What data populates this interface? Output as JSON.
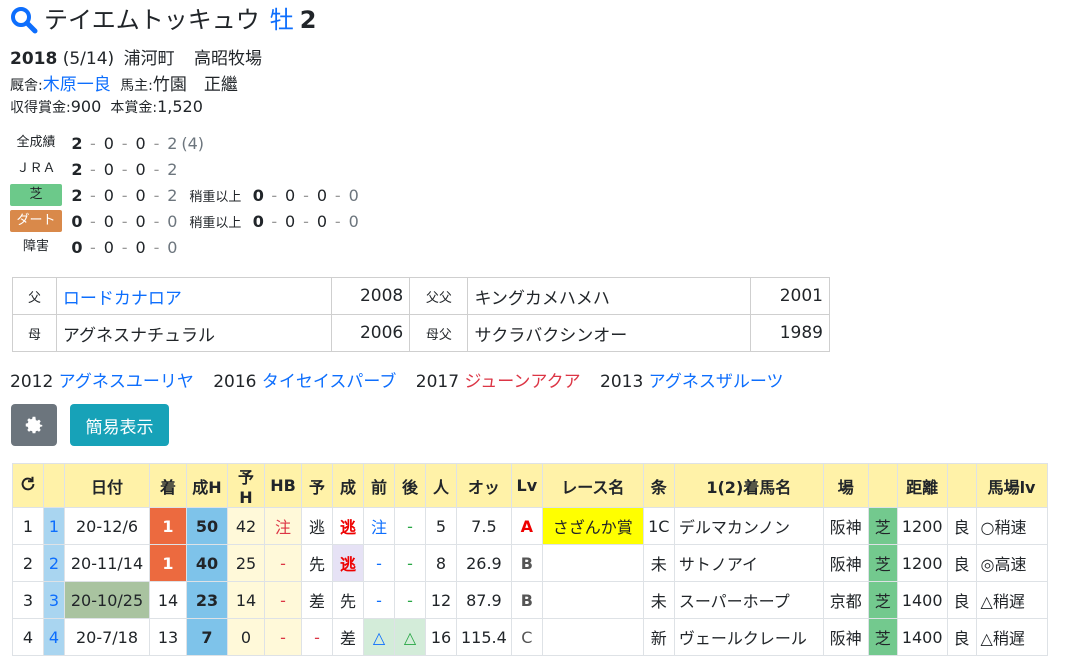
{
  "horse": {
    "name": "テイエムトッキュウ",
    "sex": "牡",
    "age": "2",
    "birth_year": "2018",
    "birth_date": "(5/14)",
    "place": "浦河町",
    "farm": "高昭牧場",
    "trainer_label": "厩舎:",
    "trainer": "木原一良",
    "owner_label": "馬主:",
    "owner": "竹園　正繼",
    "prize_label": "収得賞金:",
    "prize": "900",
    "total_prize_label": "本賞金:",
    "total_prize": "1,520"
  },
  "records": [
    {
      "label": "全成績",
      "vals": [
        "2",
        "0",
        "0",
        "2"
      ],
      "extra": "(4)"
    },
    {
      "label": "ＪＲＡ",
      "vals": [
        "2",
        "0",
        "0",
        "2"
      ]
    },
    {
      "label": "芝",
      "vals": [
        "2",
        "0",
        "0",
        "2"
      ],
      "sub_label": "稍重以上",
      "sub_vals": [
        "0",
        "0",
        "0",
        "0"
      ]
    },
    {
      "label": "ダート",
      "vals": [
        "0",
        "0",
        "0",
        "0"
      ],
      "sub_label": "稍重以上",
      "sub_vals": [
        "0",
        "0",
        "0",
        "0"
      ]
    },
    {
      "label": "障害",
      "vals": [
        "0",
        "0",
        "0",
        "0"
      ]
    }
  ],
  "pedigree": {
    "sire_label": "父",
    "sire": "ロードカナロア",
    "sire_year": "2008",
    "sire_sire_label": "父父",
    "sire_sire": "キングカメハメハ",
    "sire_sire_year": "2001",
    "dam_label": "母",
    "dam": "アグネスナチュラル",
    "dam_year": "2006",
    "dam_sire_label": "母父",
    "dam_sire": "サクラバクシンオー",
    "dam_sire_year": "1989"
  },
  "siblings": [
    {
      "year": "2012",
      "name": "アグネスユーリヤ",
      "color": "#0d6efd"
    },
    {
      "year": "2016",
      "name": "タイセイスパーブ",
      "color": "#0d6efd"
    },
    {
      "year": "2017",
      "name": "ジューンアクア",
      "color": "#dc3545"
    },
    {
      "year": "2013",
      "name": "アグネスザルーツ",
      "color": "#0d6efd"
    }
  ],
  "buttons": {
    "settings_icon": "gear-icon",
    "simple": "簡易表示"
  },
  "table": {
    "refresh_icon": "refresh-icon",
    "headers": [
      "日付",
      "着",
      "成H",
      "予H",
      "HB",
      "予",
      "成",
      "前",
      "後",
      "人",
      "オッ",
      "Lv",
      "レース名",
      "条",
      "1(2)着馬名",
      "場",
      "",
      "距離",
      "",
      "馬場lv"
    ],
    "rows": [
      [
        "1",
        "1",
        "20-12/6",
        "1",
        "50",
        "42",
        "注",
        "逃",
        "注",
        "-",
        "5",
        "7.5",
        "A",
        "さざんか賞",
        "1C",
        "デルマカンノン",
        "阪神",
        "芝",
        "1200",
        "良",
        "○稍速"
      ],
      [
        "2",
        "2",
        "20-11/14",
        "1",
        "40",
        "25",
        "-",
        "先",
        "逃",
        "-",
        "-",
        "8",
        "26.9",
        "B",
        "",
        "未",
        "サトノアイ",
        "阪神",
        "芝",
        "1200",
        "良",
        "◎高速"
      ],
      [
        "3",
        "3",
        "20-10/25",
        "14",
        "23",
        "14",
        "-",
        "差",
        "先",
        "-",
        "-",
        "12",
        "87.9",
        "B",
        "",
        "未",
        "スーパーホープ",
        "京都",
        "芝",
        "1400",
        "良",
        "△稍遅"
      ],
      [
        "4",
        "4",
        "20-7/18",
        "13",
        "7",
        "0",
        "-",
        "-",
        "差",
        "△",
        "△",
        "16",
        "115.4",
        "C",
        "",
        "新",
        "ヴェールクレール",
        "阪神",
        "芝",
        "1400",
        "良",
        "△稍遅"
      ]
    ]
  }
}
